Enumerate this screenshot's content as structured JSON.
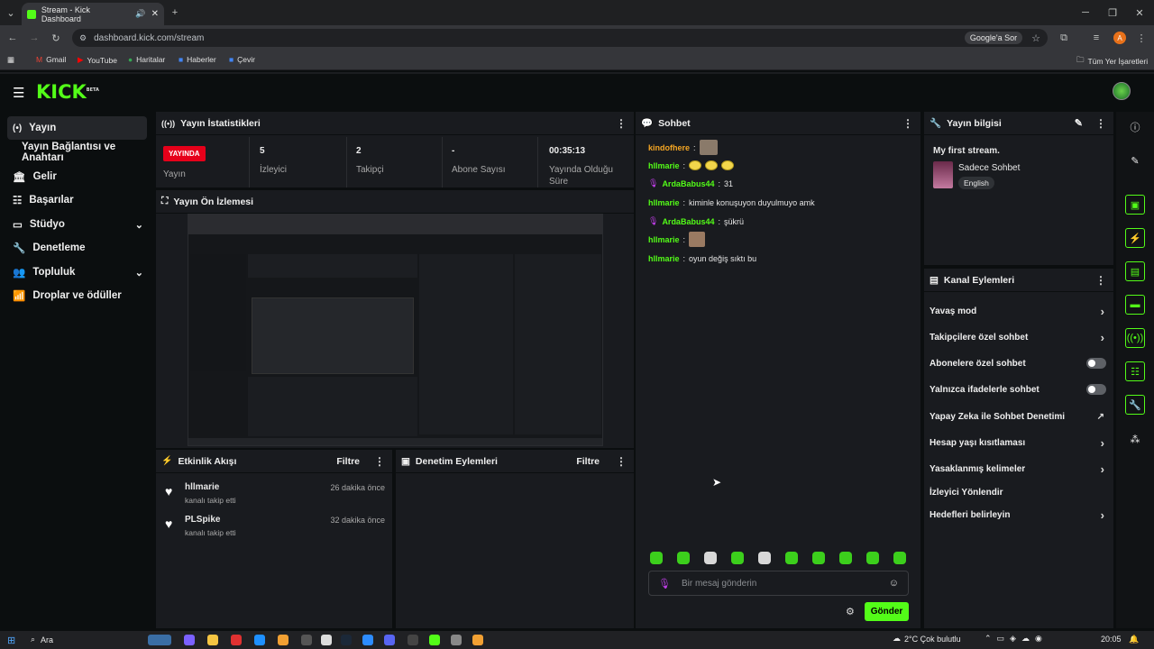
{
  "browser": {
    "tab_title": "Stream - Kick Dashboard",
    "url": "dashboard.kick.com/stream",
    "google_btn": "Google'a Sor",
    "profile_initial": "A",
    "bookmarks": [
      "Gmail",
      "YouTube",
      "Haritalar",
      "Haberler",
      "Çevir"
    ],
    "all_bookmarks": "Tüm Yer İşaretleri"
  },
  "brand": {
    "logo": "KICK",
    "beta": "BETA",
    "accent": "#53fc18"
  },
  "sidebar": {
    "items": [
      {
        "label": "Yayın",
        "icon": "broadcast-icon"
      },
      {
        "label": "Yayın Bağlantısı ve Anahtarı",
        "icon": ""
      },
      {
        "label": "Gelir",
        "icon": "bank-icon"
      },
      {
        "label": "Başarılar",
        "icon": "list-icon"
      },
      {
        "label": "Stüdyo",
        "icon": "screen-icon"
      },
      {
        "label": "Denetleme",
        "icon": "wrench-icon"
      },
      {
        "label": "Topluluk",
        "icon": "people-icon"
      },
      {
        "label": "Droplar ve ödüller",
        "icon": "chart-icon"
      }
    ]
  },
  "stats": {
    "title": "Yayın İstatistikleri",
    "live_badge": "YAYINDA",
    "live_label": "Yayın",
    "viewers_value": "5",
    "viewers_label": "İzleyici",
    "followers_value": "2",
    "followers_label": "Takipçi",
    "subs_value": "-",
    "subs_label": "Abone Sayısı",
    "uptime_value": "00:35:13",
    "uptime_label_1": "Yayında Olduğu",
    "uptime_label_2": "Süre"
  },
  "preview": {
    "title": "Yayın Ön İzlemesi"
  },
  "activity": {
    "title": "Etkinlik Akışı",
    "filter": "Filtre",
    "items": [
      {
        "user": "hllmarie",
        "action": "kanalı takip etti",
        "time": "26 dakika önce"
      },
      {
        "user": "PLSpike",
        "action": "kanalı takip etti",
        "time": "32 dakika önce"
      }
    ]
  },
  "moderation": {
    "title": "Denetim Eylemleri",
    "filter": "Filtre"
  },
  "chat": {
    "title": "Sohbet",
    "messages": [
      {
        "user": "kindofhere",
        "text": "",
        "color": "#f5a623"
      },
      {
        "user": "hllmarie",
        "text": "",
        "color": "#53fc18"
      },
      {
        "user": "ArdaBabus44",
        "text": "31",
        "color": "#53fc18"
      },
      {
        "user": "hllmarie",
        "text": "kiminle konuşuyon duyulmuyo amk",
        "color": "#53fc18"
      },
      {
        "user": "ArdaBabus44",
        "text": "şükrü",
        "color": "#53fc18"
      },
      {
        "user": "hllmarie",
        "text": "",
        "color": "#53fc18"
      },
      {
        "user": "hllmarie",
        "text": "oyun değiş sıktı bu",
        "color": "#53fc18"
      }
    ],
    "input_placeholder": "Bir mesaj gönderin",
    "send_label": "Gönder"
  },
  "stream_info": {
    "title": "Yayın bilgisi",
    "stream_title": "My first stream.",
    "category": "Sadece Sohbet",
    "language": "English"
  },
  "channel_actions": {
    "title": "Kanal Eylemleri",
    "items": [
      {
        "label": "Yavaş mod",
        "control": "chevron"
      },
      {
        "label": "Takipçilere özel sohbet",
        "control": "chevron"
      },
      {
        "label": "Abonelere özel sohbet",
        "control": "toggle-off"
      },
      {
        "label": "Yalnızca ifadelerle sohbet",
        "control": "toggle-off"
      },
      {
        "label": "Yapay Zeka ile Sohbet Denetimi",
        "control": "external"
      },
      {
        "label": "Hesap yaşı kısıtlaması",
        "control": "chevron"
      },
      {
        "label": "Yasaklanmış kelimeler",
        "control": "chevron"
      },
      {
        "label": "İzleyici Yönlendir",
        "control": "none"
      },
      {
        "label": "Hedefleri belirleyin",
        "control": "chevron"
      }
    ]
  },
  "taskbar": {
    "search": "Ara",
    "weather": "2°C  Çok bulutlu",
    "time": "20:05"
  }
}
